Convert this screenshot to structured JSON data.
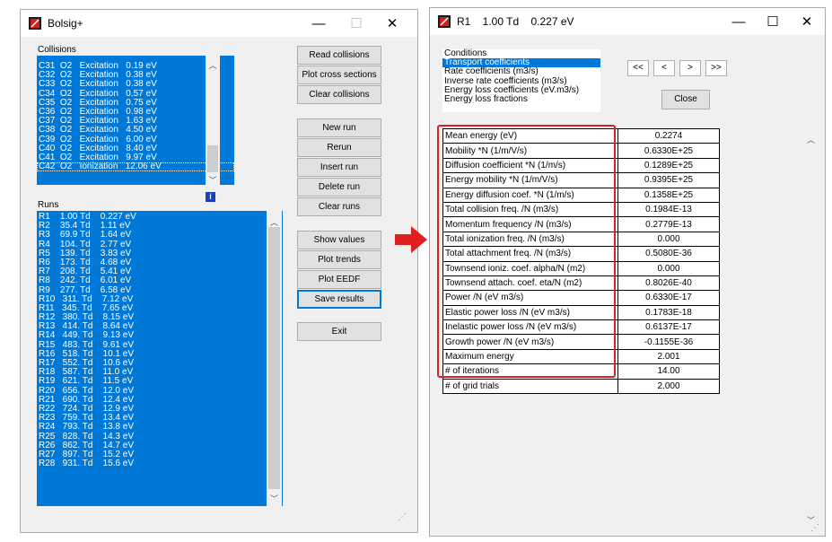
{
  "left_window": {
    "title": "Bolsig+",
    "collisions_label": "Collisions",
    "collisions": [
      "C31  O2   Excitation   0.19 eV",
      "C32  O2   Excitation   0.38 eV",
      "C33  O2   Excitation   0.38 eV",
      "C34  O2   Excitation   0.57 eV",
      "C35  O2   Excitation   0.75 eV",
      "C36  O2   Excitation   0.98 eV",
      "C37  O2   Excitation   1.63 eV",
      "C38  O2   Excitation   4.50 eV",
      "C39  O2   Excitation   6.00 eV",
      "C40  O2   Excitation   8.40 eV",
      "C41  O2   Excitation   9.97 eV",
      "C42  O2   Ionization   12.06 eV"
    ],
    "runs_label": "Runs",
    "runs": [
      "R1    1.00 Td    0.227 eV",
      "R2    35.4 Td    1.11 eV",
      "R3    69.9 Td    1.64 eV",
      "R4    104. Td    2.77 eV",
      "R5    139. Td    3.83 eV",
      "R6    173. Td    4.68 eV",
      "R7    208. Td    5.41 eV",
      "R8    242. Td    6.01 eV",
      "R9    277. Td    6.58 eV",
      "R10   311. Td    7.12 eV",
      "R11   345. Td    7.65 eV",
      "R12   380. Td    8.15 eV",
      "R13   414. Td    8.64 eV",
      "R14   449. Td    9.13 eV",
      "R15   483. Td    9.61 eV",
      "R16   518. Td    10.1 eV",
      "R17   552. Td    10.6 eV",
      "R18   587. Td    11.0 eV",
      "R19   621. Td    11.5 eV",
      "R20   656. Td    12.0 eV",
      "R21   690. Td    12.4 eV",
      "R22   724. Td    12.9 eV",
      "R23   759. Td    13.4 eV",
      "R24   793. Td    13.8 eV",
      "R25   828. Td    14.3 eV",
      "R26   862. Td    14.7 eV",
      "R27   897. Td    15.2 eV",
      "R28   931. Td    15.6 eV"
    ],
    "buttons": {
      "read_collisions": "Read collisions",
      "plot_cross_sections": "Plot cross sections",
      "clear_collisions": "Clear collisions",
      "new_run": "New run",
      "rerun": "Rerun",
      "insert_run": "Insert run",
      "delete_run": "Delete run",
      "clear_runs": "Clear runs",
      "show_values": "Show values",
      "plot_trends": "Plot trends",
      "plot_eedf": "Plot EEDF",
      "save_results": "Save results",
      "exit": "Exit"
    },
    "info_icon_glyph": "i"
  },
  "right_window": {
    "title": "R1    1.00 Td    0.227 eV",
    "conditions_list": [
      "Conditions",
      "Transport coefficients",
      "Rate coefficients (m3/s)",
      "Inverse rate coefficients (m3/s)",
      "Energy loss coefficients (eV.m3/s)",
      "Energy loss fractions"
    ],
    "selected_condition": "Transport coefficients",
    "nav": {
      "first": "<<",
      "prev": "<",
      "next": ">",
      "last": ">>"
    },
    "close_label": "Close",
    "results": [
      {
        "name": "Mean energy (eV)",
        "value": "0.2274"
      },
      {
        "name": "Mobility *N (1/m/V/s)",
        "value": "0.6330E+25"
      },
      {
        "name": "Diffusion coefficient *N (1/m/s)",
        "value": "0.1289E+25"
      },
      {
        "name": "Energy mobility *N (1/m/V/s)",
        "value": "0.9395E+25"
      },
      {
        "name": "Energy diffusion coef. *N (1/m/s)",
        "value": "0.1358E+25"
      },
      {
        "name": "Total collision freq. /N (m3/s)",
        "value": "0.1984E-13"
      },
      {
        "name": "Momentum frequency /N (m3/s)",
        "value": "0.2779E-13"
      },
      {
        "name": "Total ionization freq. /N (m3/s)",
        "value": "0.000"
      },
      {
        "name": "Total attachment freq. /N (m3/s)",
        "value": "0.5080E-36"
      },
      {
        "name": "Townsend ioniz. coef. alpha/N (m2)",
        "value": "0.000"
      },
      {
        "name": "Townsend attach. coef. eta/N (m2)",
        "value": "0.8026E-40"
      },
      {
        "name": "Power /N (eV m3/s)",
        "value": "0.6330E-17"
      },
      {
        "name": "Elastic power loss /N (eV m3/s)",
        "value": "0.1783E-18"
      },
      {
        "name": "Inelastic power loss /N (eV m3/s)",
        "value": "0.6137E-17"
      },
      {
        "name": "Growth power /N (eV m3/s)",
        "value": "-0.1155E-36"
      },
      {
        "name": "Maximum energy",
        "value": "2.001"
      },
      {
        "name": "# of iterations",
        "value": "14.00"
      },
      {
        "name": "# of grid trials",
        "value": "2.000"
      }
    ]
  },
  "colors": {
    "selection": "#0078d7",
    "highlight_box": "#e02020",
    "arrow": "#e02020"
  }
}
